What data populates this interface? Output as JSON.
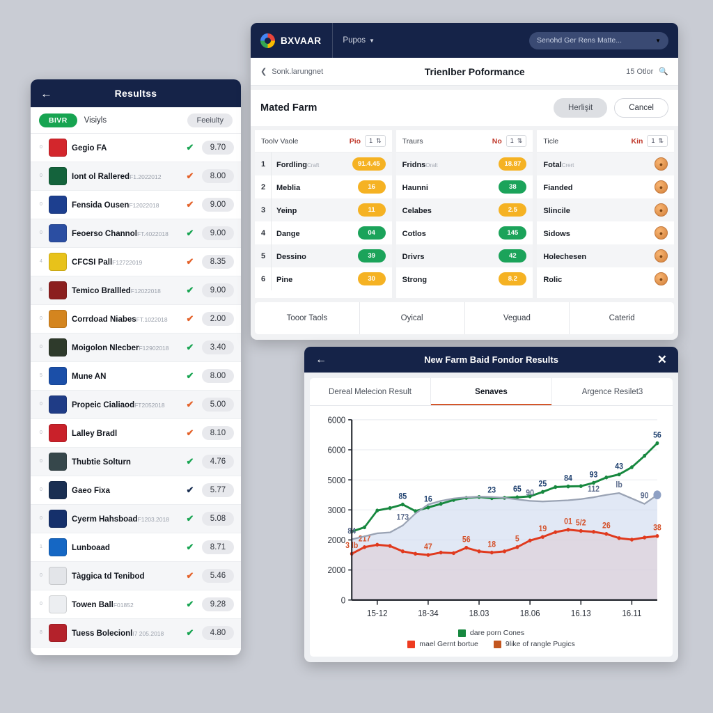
{
  "left_panel": {
    "header": {
      "back_icon": "arrow-left-icon",
      "title": "Resultss"
    },
    "filters": {
      "active_chip": "BIVR",
      "plain_chip": "Visiyls",
      "right_chip": "Feeiulty"
    },
    "rows": [
      {
        "rank": "0",
        "name": "Gegio FA",
        "sub": "",
        "score": "9.70",
        "check_color": "#17a451",
        "crest": "#d3262c"
      },
      {
        "rank": "0",
        "name": "Iont ol Rallered",
        "sub": "F1.2022012",
        "score": "8.00",
        "check_color": "#e4622a",
        "crest": "#14633c"
      },
      {
        "rank": "0",
        "name": "Fensida Ousen",
        "sub": "F12022018",
        "score": "9.00",
        "check_color": "#e4622a",
        "crest": "#1d3f8f"
      },
      {
        "rank": "0",
        "name": "Feoerso Channol",
        "sub": "FT.4022018",
        "score": "9.00",
        "check_color": "#17a451",
        "crest": "#2b4ea2"
      },
      {
        "rank": "4",
        "name": "CFCSI Pall",
        "sub": "F12722019",
        "score": "8.35",
        "check_color": "#e4622a",
        "crest": "#e8c21a"
      },
      {
        "rank": "6",
        "name": "Temico Brallled",
        "sub": "F12022018",
        "score": "9.00",
        "check_color": "#17a451",
        "crest": "#8b1f1f"
      },
      {
        "rank": "0",
        "name": "Corrdoad Niabes",
        "sub": "FT.1022018",
        "score": "2.00",
        "check_color": "#e4622a",
        "crest": "#d4851f"
      },
      {
        "rank": "0",
        "name": "Moigolon Nlecber",
        "sub": "F12902018",
        "score": "3.40",
        "check_color": "#17a451",
        "crest": "#2e3a2b"
      },
      {
        "rank": "5",
        "name": "Mune AN",
        "sub": "",
        "score": "8.00",
        "check_color": "#17a451",
        "crest": "#1b4fa8"
      },
      {
        "rank": "0",
        "name": "Propeic Cialiaod",
        "sub": "FT2052018",
        "score": "5.00",
        "check_color": "#e4622a",
        "crest": "#1f3c86"
      },
      {
        "rank": "0",
        "name": "Lalley Bradl",
        "sub": "",
        "score": "8.10",
        "check_color": "#e4622a",
        "crest": "#c9212a"
      },
      {
        "rank": "0",
        "name": "Thubtie Solturn",
        "sub": "",
        "score": "4.76",
        "check_color": "#17a451",
        "crest": "#36474b"
      },
      {
        "rank": "0",
        "name": "Gaeo Fixa",
        "sub": "",
        "score": "5.77",
        "check_color": "#1a2f52",
        "crest": "#1a2f52"
      },
      {
        "rank": "0",
        "name": "Cyerm Hahsboad",
        "sub": "F1203.2018",
        "score": "5.08",
        "check_color": "#17a451",
        "crest": "#15306b"
      },
      {
        "rank": "1",
        "name": "Lunboaad",
        "sub": "",
        "score": "8.71",
        "check_color": "#17a451",
        "crest": "#1567c4"
      },
      {
        "rank": "0",
        "name": "Tàggica td Tenibod",
        "sub": "",
        "score": "5.46",
        "check_color": "#e4622a",
        "crest": "#e3e5e9"
      },
      {
        "rank": "0",
        "name": "Towen Ball",
        "sub": "F01852",
        "score": "9.28",
        "check_color": "#17a451",
        "crest": "#eceef1"
      },
      {
        "rank": "8",
        "name": "Tuess Bolecionl",
        "sub": "I7 205.2018",
        "score": "4.80",
        "check_color": "#17a451",
        "crest": "#b4222b"
      }
    ]
  },
  "top_right_panel": {
    "appbar": {
      "logo_icon": "brand-logo-icon",
      "brand": "BXVAAR",
      "menu_label": "Pupos",
      "menu_caret_icon": "chevron-down-icon",
      "search_value": "Senohd Ger Rens Matte...",
      "search_caret_icon": "chevron-down-icon"
    },
    "subbar": {
      "back_icon": "chevron-left-icon",
      "back_label": "Sonk.larungnet",
      "page_title": "Trienlber Poformance",
      "right_label": "15 Otlor",
      "search_icon": "search-icon"
    },
    "toolbar": {
      "title": "Mated Farm",
      "primary_label": "Herlişit",
      "secondary_label": "Cancel"
    },
    "columns": [
      {
        "head_label": "Toolv Vaole",
        "head_key": "Pio",
        "stepper_value": "1",
        "has_index": true,
        "rows": [
          {
            "idx": "1",
            "title": "Fordling",
            "sub": "Craft",
            "badge": "91.4.45",
            "badge_color": "amber"
          },
          {
            "idx": "2",
            "title": "Meblia",
            "sub": "",
            "badge": "16",
            "badge_color": "amber"
          },
          {
            "idx": "3",
            "title": "Yeinp",
            "sub": "",
            "badge": "11",
            "badge_color": "amber"
          },
          {
            "idx": "4",
            "title": "Dange",
            "sub": "",
            "badge": "04",
            "badge_color": "green"
          },
          {
            "idx": "5",
            "title": "Dessino",
            "sub": "",
            "badge": "39",
            "badge_color": "green"
          },
          {
            "idx": "6",
            "title": "Pine",
            "sub": "",
            "badge": "30",
            "badge_color": "amber"
          }
        ]
      },
      {
        "head_label": "Traurs",
        "head_key": "No",
        "stepper_value": "1",
        "has_index": false,
        "rows": [
          {
            "idx": "",
            "title": "Fridns",
            "sub": "Oralt",
            "badge": "18.87",
            "badge_color": "amber"
          },
          {
            "idx": "",
            "title": "Haunni",
            "sub": "",
            "badge": "38",
            "badge_color": "green"
          },
          {
            "idx": "",
            "title": "Celabes",
            "sub": "",
            "badge": "2.5",
            "badge_color": "amber"
          },
          {
            "idx": "",
            "title": "Cotlos",
            "sub": "",
            "badge": "145",
            "badge_color": "green"
          },
          {
            "idx": "",
            "title": "Drivrs",
            "sub": "",
            "badge": "42",
            "badge_color": "green"
          },
          {
            "idx": "",
            "title": "Strong",
            "sub": "",
            "badge": "8.2",
            "badge_color": "amber"
          }
        ]
      },
      {
        "head_label": "Ticle",
        "head_key": "Kin",
        "stepper_value": "1",
        "has_index": false,
        "coin_icon": "coin-icon",
        "rows": [
          {
            "idx": "",
            "title": "Fotal",
            "sub": "Crert",
            "badge": "",
            "badge_color": "coin"
          },
          {
            "idx": "",
            "title": "Fianded",
            "sub": "",
            "badge": "",
            "badge_color": "coin"
          },
          {
            "idx": "",
            "title": "Slincile",
            "sub": "",
            "badge": "",
            "badge_color": "coin"
          },
          {
            "idx": "",
            "title": "Sidows",
            "sub": "",
            "badge": "",
            "badge_color": "coin"
          },
          {
            "idx": "",
            "title": "Holechesen",
            "sub": "",
            "badge": "",
            "badge_color": "coin"
          },
          {
            "idx": "",
            "title": "Rolic",
            "sub": "",
            "badge": "",
            "badge_color": "coin"
          }
        ]
      }
    ],
    "tabs": [
      "Tooor Taols",
      "Oyical",
      "Veguad",
      "Caterid"
    ]
  },
  "bottom_right_panel": {
    "header": {
      "back_icon": "arrow-left-icon",
      "title": "New Farm Baid Fondor Results",
      "close_icon": "close-icon"
    },
    "tabs": [
      {
        "label": "Dereal Melecion Result",
        "active": false
      },
      {
        "label": "Senaves",
        "active": true
      },
      {
        "label": "Argence Resilet3",
        "active": false
      }
    ],
    "chart_data": {
      "type": "line",
      "title": "",
      "xlabel": "",
      "ylabel": "",
      "grid": true,
      "legend_position": "bottom",
      "ylim": [
        0,
        6000
      ],
      "yticks": [
        0,
        2000,
        2000,
        3000,
        5000,
        6000,
        6000
      ],
      "ytick_labels": [
        "0",
        "2000",
        "2000",
        "3000",
        "5000",
        "6000",
        "6000"
      ],
      "x_tick_labels": [
        "15-12",
        "18-34",
        "18.03",
        "18.06",
        "16.13",
        "16.11"
      ],
      "x_tick_positions": [
        2,
        6,
        10,
        14,
        18,
        22
      ],
      "n_points": 25,
      "series": [
        {
          "name": "dare porn Cones",
          "color": "#17883f",
          "fill": false,
          "values": [
            2280,
            2420,
            2980,
            3060,
            3180,
            2960,
            3080,
            3200,
            3330,
            3400,
            3430,
            3390,
            3400,
            3420,
            3450,
            3600,
            3760,
            3780,
            3790,
            3900,
            4080,
            4180,
            4420,
            4800,
            5220
          ],
          "point_labels": [
            {
              "index": 4,
              "text": "85"
            },
            {
              "index": 6,
              "text": "16"
            },
            {
              "index": 11,
              "text": "23"
            },
            {
              "index": 13,
              "text": "65"
            },
            {
              "index": 15,
              "text": "25"
            },
            {
              "index": 17,
              "text": "84"
            },
            {
              "index": 19,
              "text": "93"
            },
            {
              "index": 21,
              "text": "43"
            },
            {
              "index": 24,
              "text": "56"
            }
          ]
        },
        {
          "name": "mael Gernt bortue",
          "color": "#e03a1e",
          "fill": true,
          "fill_color": "rgba(244,180,168,0.55)",
          "values": [
            1540,
            1760,
            1840,
            1800,
            1620,
            1540,
            1500,
            1580,
            1560,
            1740,
            1620,
            1580,
            1620,
            1760,
            1980,
            2100,
            2260,
            2340,
            2300,
            2270,
            2200,
            2060,
            2010,
            2080,
            2130
          ],
          "point_labels": [
            {
              "index": 1,
              "text": "217"
            },
            {
              "index": 0,
              "text": "3 lb"
            },
            {
              "index": 6,
              "text": "47"
            },
            {
              "index": 9,
              "text": "56"
            },
            {
              "index": 11,
              "text": "18"
            },
            {
              "index": 13,
              "text": "5"
            },
            {
              "index": 15,
              "text": "19"
            },
            {
              "index": 17,
              "text": "01"
            },
            {
              "index": 18,
              "text": "5/2"
            },
            {
              "index": 20,
              "text": "26"
            },
            {
              "index": 24,
              "text": "38"
            }
          ]
        },
        {
          "name": "9like of rangle Pugics",
          "color": "#9aa3b4",
          "fill": true,
          "fill_color": "rgba(205,216,238,0.60)",
          "values": [
            2020,
            2120,
            2220,
            2250,
            2480,
            2880,
            3180,
            3300,
            3380,
            3420,
            3440,
            3430,
            3400,
            3350,
            3300,
            3280,
            3300,
            3320,
            3360,
            3420,
            3500,
            3560,
            3380,
            3200,
            3500
          ],
          "point_labels": [
            {
              "index": 0,
              "text": "84"
            },
            {
              "index": 4,
              "text": "173"
            },
            {
              "index": 14,
              "text": "90"
            },
            {
              "index": 19,
              "text": "112"
            },
            {
              "index": 21,
              "text": "lb"
            },
            {
              "index": 23,
              "text": "90"
            }
          ]
        }
      ]
    },
    "legend_rows": [
      [
        {
          "label": "dare porn Cones",
          "color": "#17883f"
        }
      ],
      [
        {
          "label": "mael Gernt bortue",
          "color": "#ee3b20"
        },
        {
          "label": "9like of rangle Pugics",
          "color": "#c3561f"
        }
      ]
    ]
  }
}
